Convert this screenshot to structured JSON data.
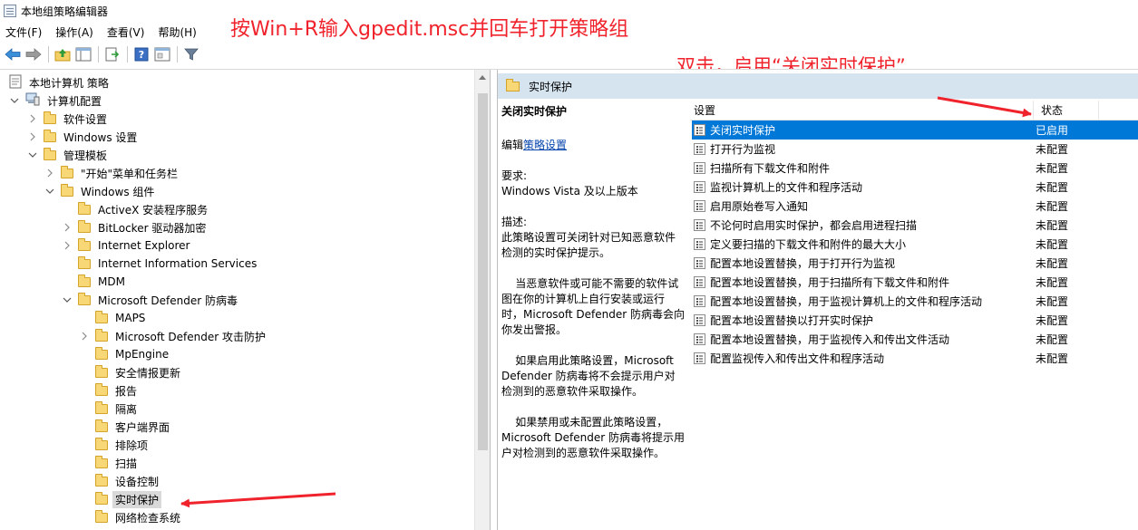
{
  "window": {
    "title": "本地组策略编辑器"
  },
  "menu": [
    "文件(F)",
    "操作(A)",
    "查看(V)",
    "帮助(H)"
  ],
  "annotations": {
    "top": "按Win+R输入gpedit.msc并回车打开策略组",
    "right": "双击，启用“关闭实时保护”"
  },
  "toolbar": {
    "icons": [
      "back-arrow-icon",
      "forward-arrow-icon",
      "up-folder-icon",
      "show-hide-tree-icon",
      "export-list-icon",
      "help-icon",
      "properties-icon",
      "filter-icon"
    ]
  },
  "tree": [
    {
      "label": "本地计算机 策略",
      "level": 0,
      "expander": "none",
      "icon": "policy-icon"
    },
    {
      "label": "计算机配置",
      "level": 0,
      "expander": "expanded",
      "icon": "computer-icon"
    },
    {
      "label": "软件设置",
      "level": 1,
      "expander": "collapsed",
      "icon": "folder-icon"
    },
    {
      "label": "Windows 设置",
      "level": 1,
      "expander": "collapsed",
      "icon": "folder-icon"
    },
    {
      "label": "管理模板",
      "level": 1,
      "expander": "expanded",
      "icon": "folder-icon"
    },
    {
      "label": "\"开始\"菜单和任务栏",
      "level": 2,
      "expander": "collapsed",
      "icon": "folder-icon"
    },
    {
      "label": "Windows 组件",
      "level": 2,
      "expander": "expanded",
      "icon": "folder-icon"
    },
    {
      "label": "ActiveX 安装程序服务",
      "level": 3,
      "expander": "none",
      "icon": "folder-icon"
    },
    {
      "label": "BitLocker 驱动器加密",
      "level": 3,
      "expander": "collapsed",
      "icon": "folder-icon"
    },
    {
      "label": "Internet Explorer",
      "level": 3,
      "expander": "collapsed",
      "icon": "folder-icon"
    },
    {
      "label": "Internet Information Services",
      "level": 3,
      "expander": "none",
      "icon": "folder-icon"
    },
    {
      "label": "MDM",
      "level": 3,
      "expander": "none",
      "icon": "folder-icon"
    },
    {
      "label": "Microsoft Defender 防病毒",
      "level": 3,
      "expander": "expanded",
      "icon": "folder-icon"
    },
    {
      "label": "MAPS",
      "level": 4,
      "expander": "none",
      "icon": "folder-icon"
    },
    {
      "label": "Microsoft Defender 攻击防护",
      "level": 4,
      "expander": "collapsed",
      "icon": "folder-icon"
    },
    {
      "label": "MpEngine",
      "level": 4,
      "expander": "none",
      "icon": "folder-icon"
    },
    {
      "label": "安全情报更新",
      "level": 4,
      "expander": "none",
      "icon": "folder-icon"
    },
    {
      "label": "报告",
      "level": 4,
      "expander": "none",
      "icon": "folder-icon"
    },
    {
      "label": "隔离",
      "level": 4,
      "expander": "none",
      "icon": "folder-icon"
    },
    {
      "label": "客户端界面",
      "level": 4,
      "expander": "none",
      "icon": "folder-icon"
    },
    {
      "label": "排除项",
      "level": 4,
      "expander": "none",
      "icon": "folder-icon"
    },
    {
      "label": "扫描",
      "level": 4,
      "expander": "none",
      "icon": "folder-icon"
    },
    {
      "label": "设备控制",
      "level": 4,
      "expander": "none",
      "icon": "folder-icon"
    },
    {
      "label": "实时保护",
      "level": 4,
      "expander": "none",
      "icon": "folder-icon",
      "selected": true
    },
    {
      "label": "网络检查系统",
      "level": 4,
      "expander": "none",
      "icon": "folder-icon"
    }
  ],
  "right_pane": {
    "header": "实时保护",
    "description": {
      "title": "关闭实时保护",
      "edit_prefix": "编辑",
      "edit_link": "策略设置",
      "requirement": "要求:\nWindows Vista 及以上版本",
      "desc_1": "描述:\n此策略设置可关闭针对已知恶意软件检测的实时保护提示。",
      "desc_2": "    当恶意软件或可能不需要的软件试图在你的计算机上自行安装或运行时，Microsoft Defender 防病毒会向你发出警报。",
      "desc_3": "    如果启用此策略设置，Microsoft Defender 防病毒将不会提示用户对检测到的恶意软件采取操作。",
      "desc_4": "    如果禁用或未配置此策略设置，Microsoft Defender 防病毒将提示用户对检测到的恶意软件采取操作。"
    },
    "columns": {
      "setting": "设置",
      "state": "状态"
    },
    "settings": [
      {
        "name": "关闭实时保护",
        "state": "已启用",
        "selected": true
      },
      {
        "name": "打开行为监视",
        "state": "未配置"
      },
      {
        "name": "扫描所有下载文件和附件",
        "state": "未配置"
      },
      {
        "name": "监视计算机上的文件和程序活动",
        "state": "未配置"
      },
      {
        "name": "启用原始卷写入通知",
        "state": "未配置"
      },
      {
        "name": "不论何时启用实时保护，都会启用进程扫描",
        "state": "未配置"
      },
      {
        "name": "定义要扫描的下载文件和附件的最大大小",
        "state": "未配置"
      },
      {
        "name": "配置本地设置替换，用于打开行为监视",
        "state": "未配置"
      },
      {
        "name": "配置本地设置替换，用于扫描所有下载文件和附件",
        "state": "未配置"
      },
      {
        "name": "配置本地设置替换，用于监视计算机上的文件和程序活动",
        "state": "未配置"
      },
      {
        "name": "配置本地设置替换以打开实时保护",
        "state": "未配置"
      },
      {
        "name": "配置本地设置替换，用于监视传入和传出文件活动",
        "state": "未配置"
      },
      {
        "name": "配置监视传入和传出文件和程序活动",
        "state": "未配置"
      }
    ]
  },
  "colors": {
    "accent": "#0078d7",
    "annotation": "#f0232c",
    "header_band": "#d6e4f0"
  }
}
